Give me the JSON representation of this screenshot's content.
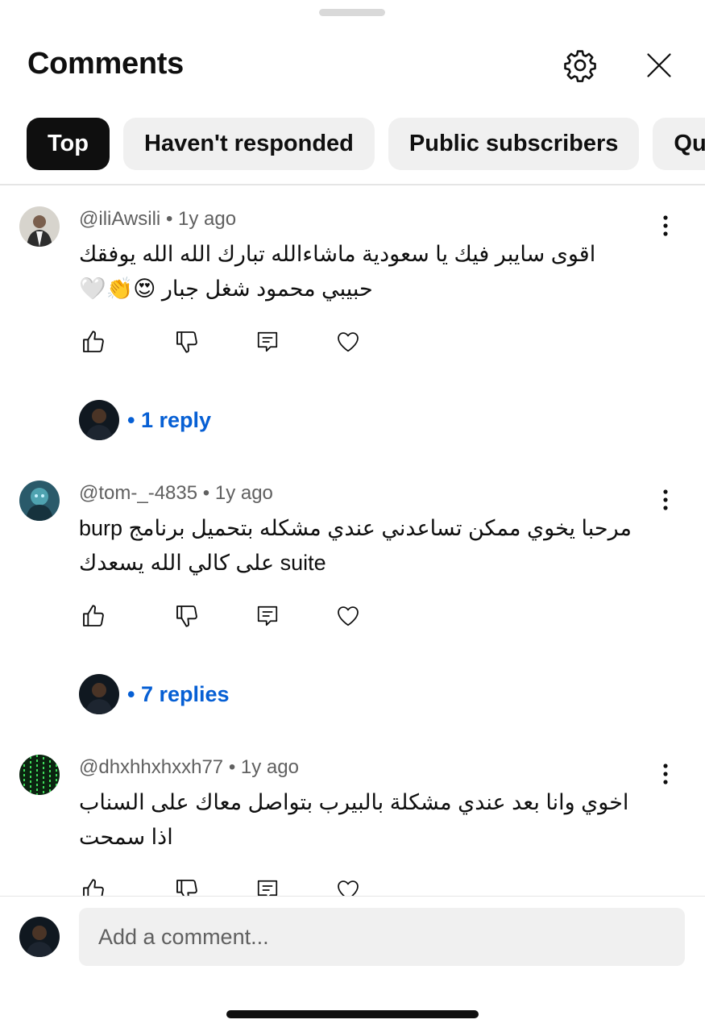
{
  "sheet": {
    "title": "Comments",
    "settings_icon": "gear-icon",
    "close_icon": "close-icon"
  },
  "filters": [
    {
      "label": "Top",
      "active": true
    },
    {
      "label": "Haven't responded",
      "active": false
    },
    {
      "label": "Public subscribers",
      "active": false
    },
    {
      "label": "Que",
      "active": false
    }
  ],
  "comments": [
    {
      "author": "@iliAwsili",
      "time": "1y ago",
      "text": "اقوى سايبر فيك يا سعودية ماشاءالله تبارك الله الله يوفقك حبيبي محمود شغل جبار 😍👏🤍",
      "replies_label": "• 1 reply"
    },
    {
      "author": "@tom-_-4835",
      "time": "1y ago",
      "text": "مرحبا يخوي ممكن تساعدني عندي مشكله بتحميل برنامج burp suite على كالي الله يسعدك",
      "replies_label": "• 7 replies"
    },
    {
      "author": "@dhxhhxhxxh77",
      "time": "1y ago",
      "text": "اخوي وانا بعد عندي مشكلة بالبيرب بتواصل معاك على السناب اذا سمحت",
      "replies_label": ""
    }
  ],
  "meta_separator": "•",
  "composer": {
    "placeholder": "Add a comment..."
  },
  "colors": {
    "accent_link": "#065fd4",
    "chip_active": "#0f0f0f",
    "chip_bg": "#f0f0f0",
    "secondary_text": "#606060"
  }
}
